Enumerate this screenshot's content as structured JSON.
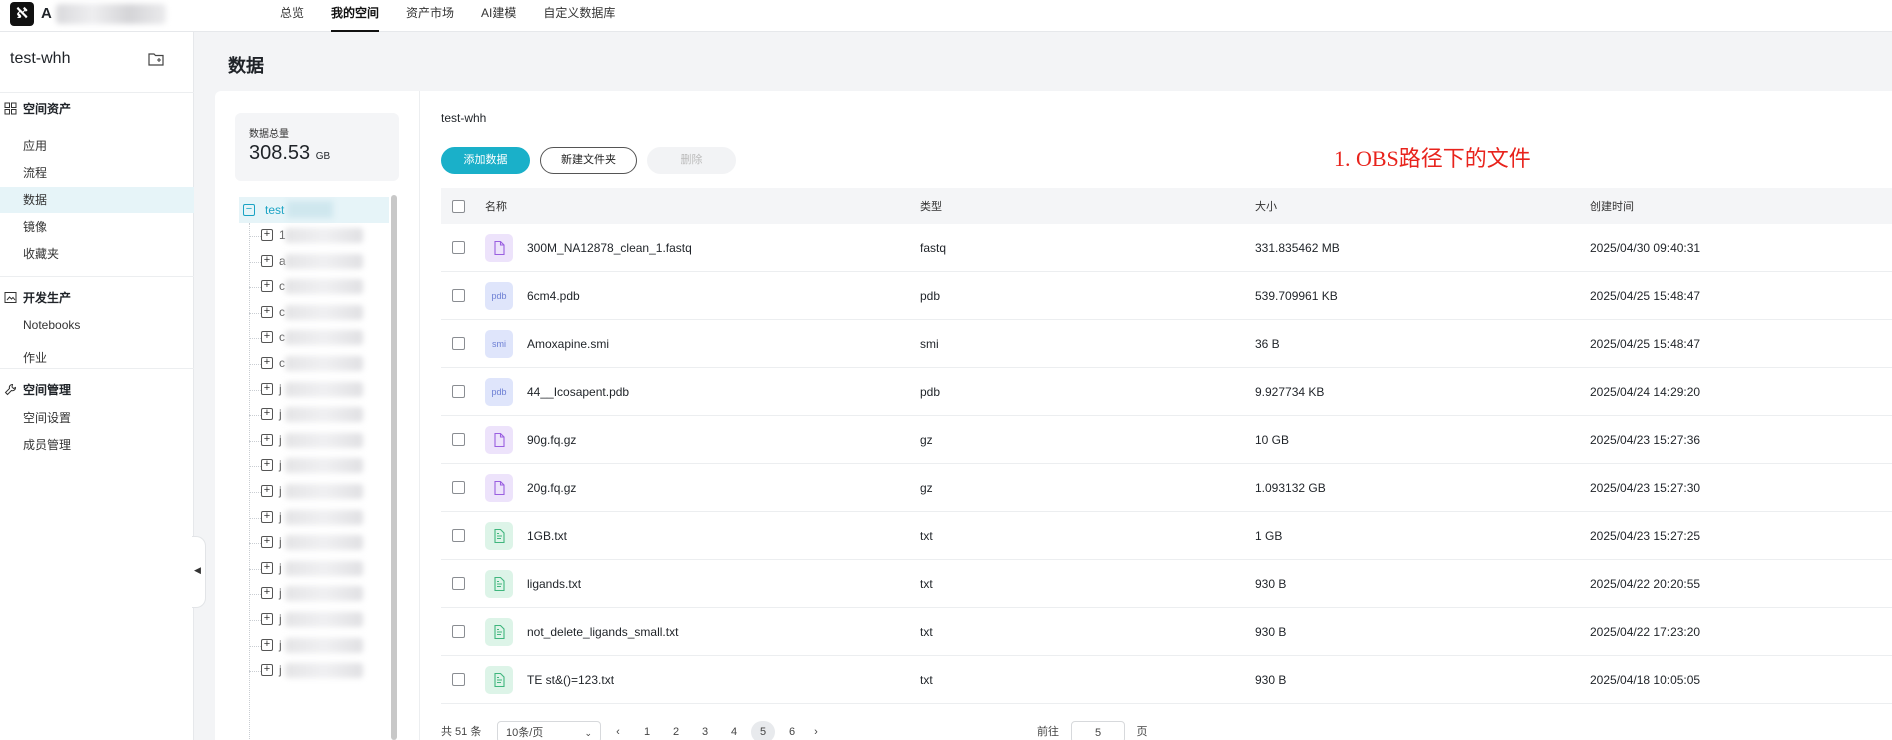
{
  "topbar": {
    "logo_glyph": "ℵ",
    "brand_initial": "A",
    "nav": [
      {
        "label": "总览",
        "active": false
      },
      {
        "label": "我的空间",
        "active": true
      },
      {
        "label": "资产市场",
        "active": false
      },
      {
        "label": "AI建模",
        "active": false
      },
      {
        "label": "自定义数据库",
        "active": false
      }
    ]
  },
  "sidebar": {
    "space_name": "test-whh",
    "groups": [
      {
        "title": "空间资产",
        "icon": "grid-icon",
        "items": [
          {
            "label": "应用",
            "active": false
          },
          {
            "label": "流程",
            "active": false
          },
          {
            "label": "数据",
            "active": true
          },
          {
            "label": "镜像",
            "active": false
          },
          {
            "label": "收藏夹",
            "active": false
          }
        ]
      },
      {
        "title": "开发生产",
        "icon": "image-icon",
        "items": [
          {
            "label": "Notebooks",
            "active": false
          },
          {
            "label": "作业",
            "active": false
          }
        ]
      },
      {
        "title": "空间管理",
        "icon": "wrench-icon",
        "items": [
          {
            "label": "空间设置",
            "active": false
          },
          {
            "label": "成员管理",
            "active": false
          }
        ]
      }
    ]
  },
  "page": {
    "title": "数据"
  },
  "stats": {
    "label": "数据总量",
    "value": "308.53",
    "unit": "GB"
  },
  "tree": {
    "root_label": "test",
    "nodes": [
      "1",
      "a",
      "c",
      "c",
      "c",
      "c",
      "j",
      "j",
      "j",
      "j",
      "j",
      "j",
      "j",
      "j",
      "j",
      "j",
      "j",
      "j"
    ]
  },
  "content": {
    "breadcrumb": "test-whh",
    "buttons": {
      "add": "添加数据",
      "new_folder": "新建文件夹",
      "delete": "删除"
    },
    "annotation": "1. OBS路径下的文件"
  },
  "table": {
    "headers": {
      "name": "名称",
      "type": "类型",
      "size": "大小",
      "created": "创建时间"
    },
    "rows": [
      {
        "name": "300M_NA12878_clean_1.fastq",
        "type": "fastq",
        "size": "331.835462 MB",
        "created": "2025/04/30 09:40:31",
        "icon": "file-icon",
        "icon_color": "purple",
        "icon_text": ""
      },
      {
        "name": "6cm4.pdb",
        "type": "pdb",
        "size": "539.709961 KB",
        "created": "2025/04/25 15:48:47",
        "icon": "pdb-file-icon",
        "icon_color": "blue",
        "icon_text": "pdb"
      },
      {
        "name": "Amoxapine.smi",
        "type": "smi",
        "size": "36 B",
        "created": "2025/04/25 15:48:47",
        "icon": "smi-file-icon",
        "icon_color": "blue",
        "icon_text": "smi"
      },
      {
        "name": "44__Icosapent.pdb",
        "type": "pdb",
        "size": "9.927734 KB",
        "created": "2025/04/24 14:29:20",
        "icon": "pdb-file-icon",
        "icon_color": "blue",
        "icon_text": "pdb"
      },
      {
        "name": "90g.fq.gz",
        "type": "gz",
        "size": "10 GB",
        "created": "2025/04/23 15:27:36",
        "icon": "file-icon",
        "icon_color": "purple",
        "icon_text": ""
      },
      {
        "name": "20g.fq.gz",
        "type": "gz",
        "size": "1.093132 GB",
        "created": "2025/04/23 15:27:30",
        "icon": "file-icon",
        "icon_color": "purple",
        "icon_text": ""
      },
      {
        "name": "1GB.txt",
        "type": "txt",
        "size": "1 GB",
        "created": "2025/04/23 15:27:25",
        "icon": "text-file-icon",
        "icon_color": "green",
        "icon_text": ""
      },
      {
        "name": "ligands.txt",
        "type": "txt",
        "size": "930 B",
        "created": "2025/04/22 20:20:55",
        "icon": "text-file-icon",
        "icon_color": "green",
        "icon_text": ""
      },
      {
        "name": "not_delete_ligands_small.txt",
        "type": "txt",
        "size": "930 B",
        "created": "2025/04/22 17:23:20",
        "icon": "text-file-icon",
        "icon_color": "green",
        "icon_text": ""
      },
      {
        "name": "TE st&()=123.txt",
        "type": "txt",
        "size": "930 B",
        "created": "2025/04/18 10:05:05",
        "icon": "text-file-icon",
        "icon_color": "green",
        "icon_text": ""
      }
    ]
  },
  "pager": {
    "total": "共 51 条",
    "page_size": "10条/页",
    "pages": [
      "1",
      "2",
      "3",
      "4",
      "5",
      "6"
    ],
    "current": "5",
    "goto_label": "前往",
    "goto_value": "5",
    "page_suffix": "页"
  },
  "colors": {
    "accent": "#1ab0c9",
    "annotation": "#e8231c",
    "active_bg": "#e6f4f8"
  }
}
